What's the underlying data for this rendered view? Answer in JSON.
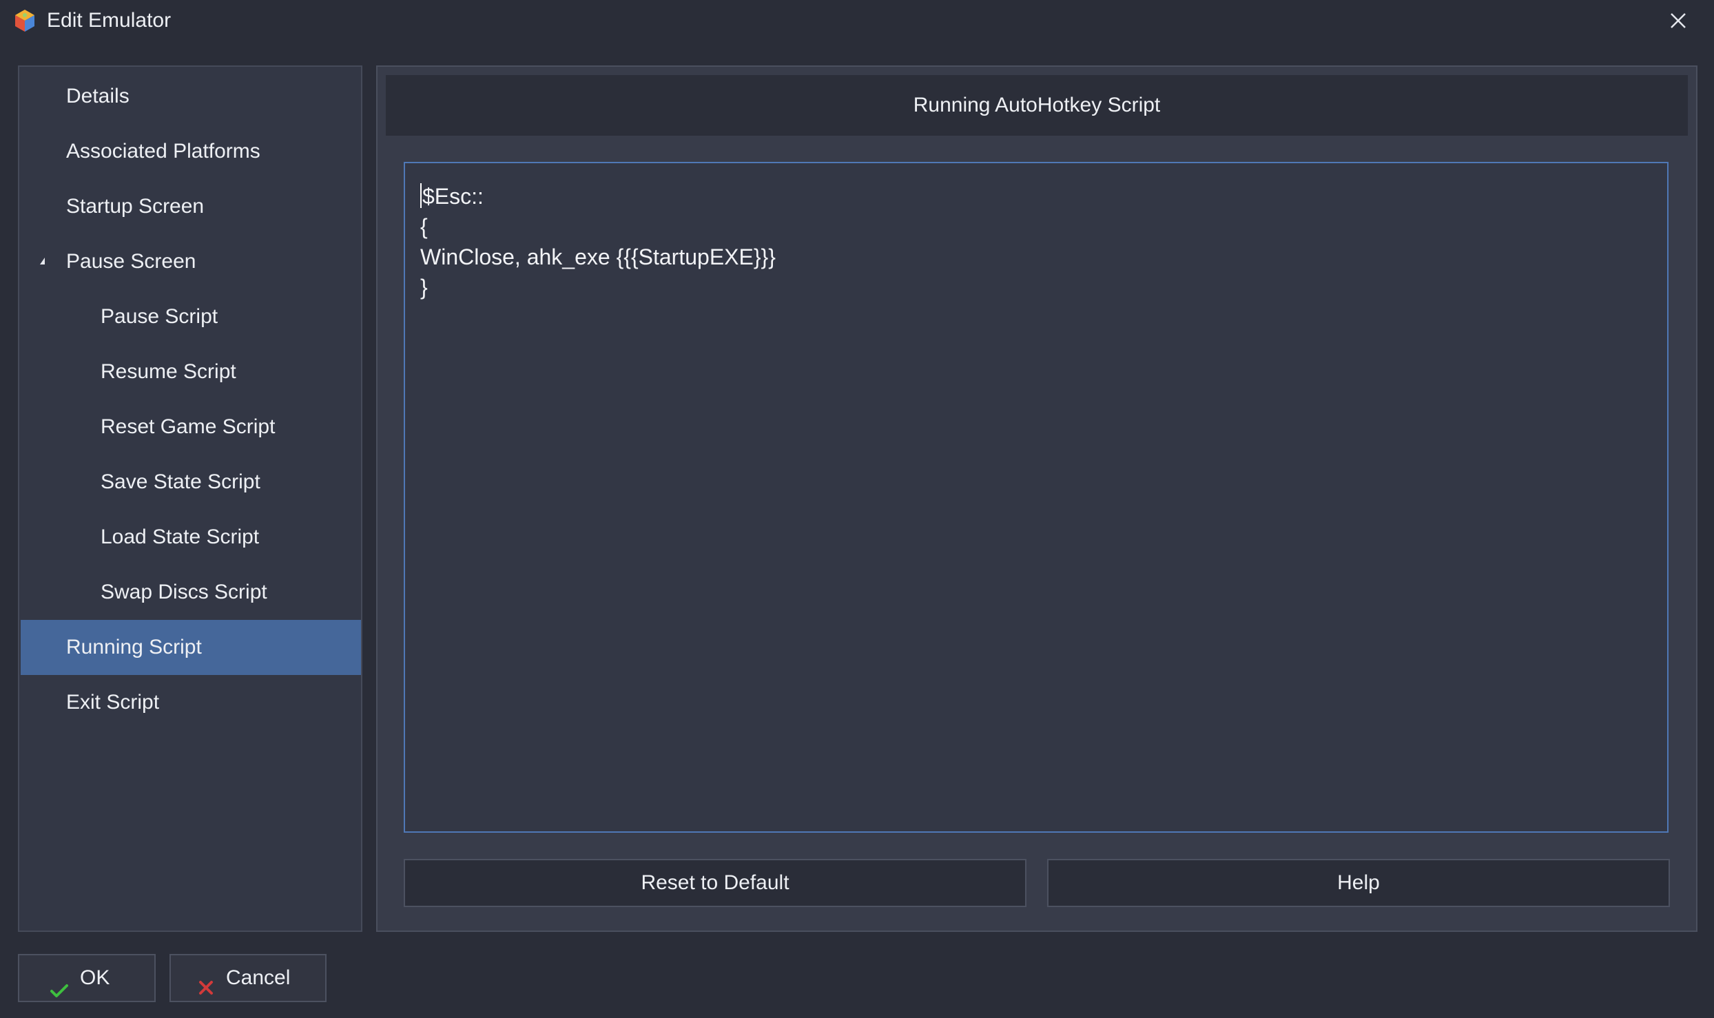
{
  "window": {
    "title": "Edit Emulator"
  },
  "sidebar": {
    "items": [
      {
        "label": "Details",
        "level": 0
      },
      {
        "label": "Associated Platforms",
        "level": 0
      },
      {
        "label": "Startup Screen",
        "level": 0
      },
      {
        "label": "Pause Screen",
        "level": 0,
        "expanded": true
      },
      {
        "label": "Pause Script",
        "level": 1
      },
      {
        "label": "Resume Script",
        "level": 1
      },
      {
        "label": "Reset Game Script",
        "level": 1
      },
      {
        "label": "Save State Script",
        "level": 1
      },
      {
        "label": "Load State Script",
        "level": 1
      },
      {
        "label": "Swap Discs Script",
        "level": 1
      },
      {
        "label": "Running Script",
        "level": 0,
        "selected": true
      },
      {
        "label": "Exit Script",
        "level": 0
      }
    ]
  },
  "main": {
    "header": "Running AutoHotkey Script",
    "script_lines": [
      "$Esc::",
      "{",
      "WinClose, ahk_exe {{{StartupEXE}}}",
      "}"
    ],
    "reset_label": "Reset to Default",
    "help_label": "Help"
  },
  "footer": {
    "ok_label": "OK",
    "cancel_label": "Cancel"
  },
  "colors": {
    "background": "#2a2d38",
    "selected": "#45679a",
    "editor_border": "#4f78b6",
    "ok_icon": "#3fbf3f",
    "cancel_icon": "#d23a3a"
  },
  "icons": {
    "app": "app-icon",
    "close": "close-icon",
    "ok": "checkmark-icon",
    "cancel": "x-icon",
    "expander": "expander-triangle-icon"
  }
}
